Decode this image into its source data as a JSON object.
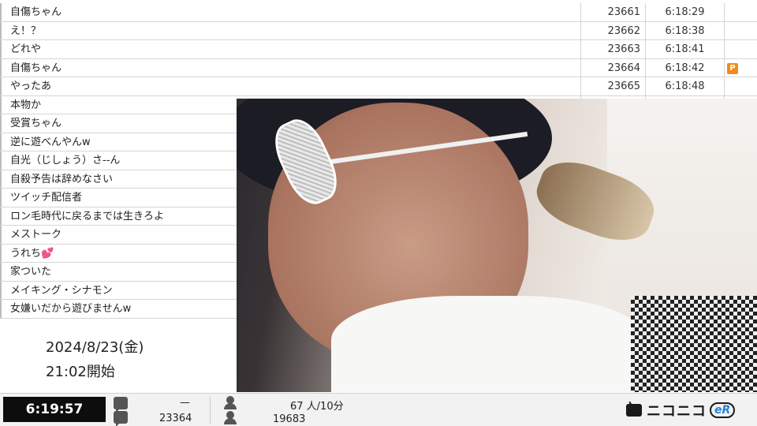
{
  "comments": [
    {
      "text": "自傷ちゃん",
      "no": "23661",
      "time": "6:18:29",
      "premium": false
    },
    {
      "text": "え！？",
      "no": "23662",
      "time": "6:18:38",
      "premium": false
    },
    {
      "text": "どれや",
      "no": "23663",
      "time": "6:18:41",
      "premium": false
    },
    {
      "text": "自傷ちゃん",
      "no": "23664",
      "time": "6:18:42",
      "premium": true
    },
    {
      "text": "やったあ",
      "no": "23665",
      "time": "6:18:48",
      "premium": false
    },
    {
      "text": "本物か",
      "no": "",
      "time": "",
      "premium": false
    },
    {
      "text": "受賞ちゃん",
      "no": "",
      "time": "",
      "premium": false
    },
    {
      "text": "逆に遊べんやんw",
      "no": "",
      "time": "",
      "premium": false
    },
    {
      "text": "自光（じしょう）さ--ん",
      "no": "",
      "time": "",
      "premium": false
    },
    {
      "text": "自殺予告は辞めなさい",
      "no": "",
      "time": "",
      "premium": false
    },
    {
      "text": "ツイッチ配信者",
      "no": "",
      "time": "",
      "premium": false
    },
    {
      "text": "ロン毛時代に戻るまでは生きろよ",
      "no": "",
      "time": "",
      "premium": false
    },
    {
      "text": "メストーク",
      "no": "",
      "time": "",
      "premium": false
    },
    {
      "text": "うれち💕",
      "no": "",
      "time": "",
      "premium": false
    },
    {
      "text": "家ついた",
      "no": "",
      "time": "",
      "premium": false
    },
    {
      "text": "メイキング・シナモン",
      "no": "",
      "time": "",
      "premium": false
    },
    {
      "text": "女嫌いだから遊びませんw",
      "no": "",
      "time": "",
      "premium": false
    }
  ],
  "premium_badge": "P",
  "broadcast": {
    "date": "2024/8/23(金)",
    "start": "21:02開始"
  },
  "status": {
    "elapsed": "6:19:57",
    "comment_rate": "—",
    "comment_total": "23364",
    "viewers_rate": "67 人/10分",
    "viewers_total": "19683"
  },
  "logo": {
    "name": "ニコニコ",
    "suffix": "eR"
  },
  "colors": {
    "premium": "#f08c1c",
    "clock_bg": "#0d0d0d"
  }
}
